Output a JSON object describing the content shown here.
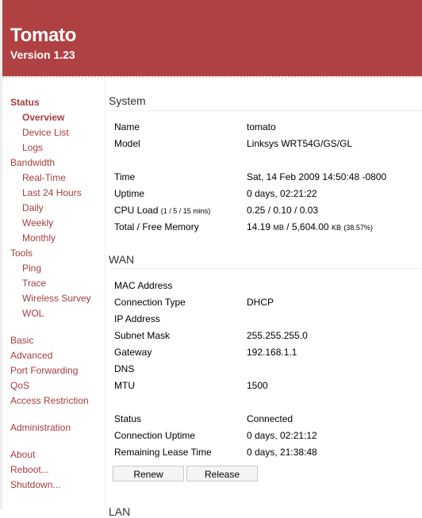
{
  "header": {
    "title": "Tomato",
    "version": "Version 1.23",
    "brand_color": "#b04142"
  },
  "sidebar": {
    "groups": [
      {
        "label": "Status",
        "bold": true,
        "items": [
          "Overview",
          "Device List",
          "Logs"
        ],
        "active_item": "Overview"
      },
      {
        "label": "Bandwidth",
        "items": [
          "Real-Time",
          "Last 24 Hours",
          "Daily",
          "Weekly",
          "Monthly"
        ]
      },
      {
        "label": "Tools",
        "items": [
          "Ping",
          "Trace",
          "Wireless Survey",
          "WOL"
        ]
      }
    ],
    "links": [
      "Basic",
      "Advanced",
      "Port Forwarding",
      "QoS",
      "Access Restriction",
      "Administration",
      "About",
      "Reboot...",
      "Shutdown..."
    ],
    "link_color": "#a53c3f"
  },
  "system": {
    "title": "System",
    "name_label": "Name",
    "name_value": "tomato",
    "model_label": "Model",
    "model_value": "Linksys WRT54G/GS/GL",
    "time_label": "Time",
    "time_value": "Sat, 14 Feb 2009 14:50:48 -0800",
    "uptime_label": "Uptime",
    "uptime_value": "0 days, 02:21:22",
    "cpu_label": "CPU Load",
    "cpu_note": "(1 / 5 / 15 mins)",
    "cpu_value": "0.25 / 0.10 / 0.03",
    "mem_label": "Total / Free Memory",
    "mem_total": "14.19",
    "mem_total_unit": "MB",
    "mem_sep": " / ",
    "mem_free": "5,604.00",
    "mem_free_unit": "KB",
    "mem_pct": "(38.57%)"
  },
  "wan": {
    "title": "WAN",
    "rows": [
      {
        "label": "MAC Address",
        "value": ""
      },
      {
        "label": "Connection Type",
        "value": "DHCP"
      },
      {
        "label": "IP Address",
        "value": ""
      },
      {
        "label": "Subnet Mask",
        "value": "255.255.255.0"
      },
      {
        "label": "Gateway",
        "value": "192.168.1.1"
      },
      {
        "label": "DNS",
        "value": ""
      },
      {
        "label": "MTU",
        "value": "1500"
      }
    ],
    "status_rows": [
      {
        "label": "Status",
        "value": "Connected"
      },
      {
        "label": "Connection Uptime",
        "value": "0 days, 02:21:12"
      },
      {
        "label": "Remaining Lease Time",
        "value": "0 days, 21:38:48"
      }
    ],
    "renew_label": "Renew",
    "release_label": "Release"
  },
  "lan": {
    "title": "LAN"
  }
}
